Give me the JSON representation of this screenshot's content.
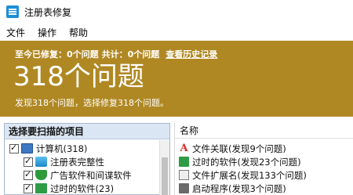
{
  "window": {
    "title": "注册表修复",
    "icon": "registry-app-icon"
  },
  "menu": {
    "items": [
      "文件",
      "操作",
      "帮助"
    ]
  },
  "banner": {
    "fixed_label": "至今已修复：0个问题",
    "total_label": "共计：0个问题",
    "history_link": "查看历史记录",
    "big_count": "318个问题",
    "subtext": "发现318个问题，选择修复318个问题。",
    "color": "#b08823"
  },
  "scan_panel": {
    "header": "选择要扫描的项目",
    "items": [
      {
        "label": "计算机(318)",
        "checked": true,
        "icon": "computer-icon"
      },
      {
        "label": "注册表完整性",
        "checked": true,
        "icon": "registry-icon"
      },
      {
        "label": "广告软件和间谍软件",
        "checked": true,
        "icon": "shield-icon"
      },
      {
        "label": "过时的软件(23)",
        "checked": true,
        "icon": "trash-icon"
      }
    ]
  },
  "results_panel": {
    "header": "名称",
    "rows": [
      {
        "label": "文件关联(发现9个问题)",
        "icon": "file-association-icon"
      },
      {
        "label": "过时的软件(发现23个问题)",
        "icon": "obsolete-software-icon"
      },
      {
        "label": "文件扩展名(发现133个问题)",
        "icon": "file-extension-icon"
      },
      {
        "label": "启动程序(发现3个问题)",
        "icon": "startup-icon"
      }
    ]
  }
}
